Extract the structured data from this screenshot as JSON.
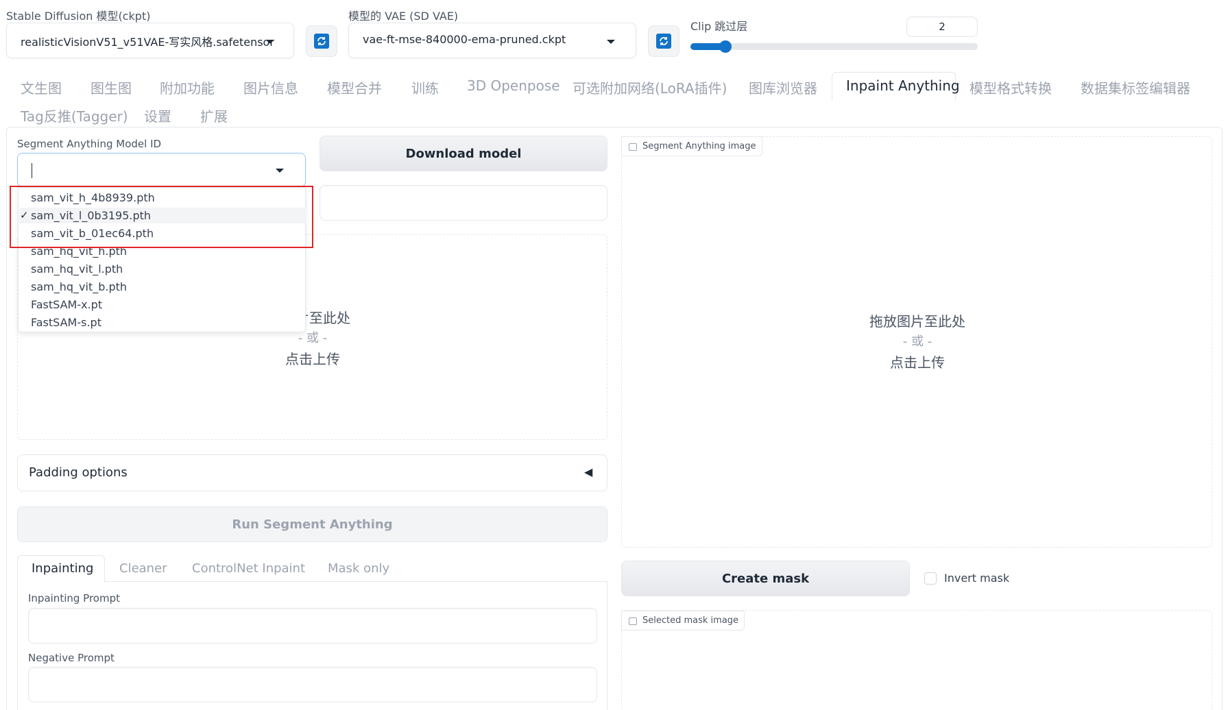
{
  "header": {
    "sd_model_label": "Stable Diffusion 模型(ckpt)",
    "sd_model_value": "realisticVisionV51_v51VAE-写实风格.safetensor",
    "vae_label": "模型的 VAE (SD VAE)",
    "vae_value": "vae-ft-mse-840000-ema-pruned.ckpt",
    "clip_label": "Clip 跳过层",
    "clip_value": "2",
    "clip_slider_fraction": 0.1
  },
  "tabs": [
    {
      "label": "文生图"
    },
    {
      "label": "图生图"
    },
    {
      "label": "附加功能"
    },
    {
      "label": "图片信息"
    },
    {
      "label": "模型合并"
    },
    {
      "label": "训练"
    },
    {
      "label": "3D Openpose"
    },
    {
      "label": "可选附加网络(LoRA插件)"
    },
    {
      "label": "图库浏览器"
    },
    {
      "label": "Inpaint Anything"
    },
    {
      "label": "模型格式转换"
    },
    {
      "label": "数据集标签编辑器"
    },
    {
      "label": "Tag反推(Tagger)"
    },
    {
      "label": "设置"
    },
    {
      "label": "扩展"
    }
  ],
  "left": {
    "model_id_label": "Segment Anything Model ID",
    "model_id_value": "",
    "download_button": "Download model",
    "download_status": "",
    "dropdown_options": [
      {
        "label": "sam_vit_h_4b8939.pth",
        "selected": false
      },
      {
        "label": "sam_vit_l_0b3195.pth",
        "selected": true
      },
      {
        "label": "sam_vit_b_01ec64.pth",
        "selected": false
      },
      {
        "label": "sam_hq_vit_h.pth",
        "selected": false
      },
      {
        "label": "sam_hq_vit_l.pth",
        "selected": false
      },
      {
        "label": "sam_hq_vit_b.pth",
        "selected": false
      },
      {
        "label": "FastSAM-x.pt",
        "selected": false
      },
      {
        "label": "FastSAM-s.pt",
        "selected": false
      }
    ],
    "check_mark": "✓",
    "upload_line1": "片至此处",
    "upload_or": "- 或 -",
    "upload_line3": "点击上传",
    "padding_label": "Padding options",
    "padding_toggle": "◀",
    "run_button": "Run Segment Anything",
    "subtabs": [
      {
        "label": "Inpainting"
      },
      {
        "label": "Cleaner"
      },
      {
        "label": "ControlNet Inpaint"
      },
      {
        "label": "Mask only"
      }
    ],
    "inpainting_prompt_label": "Inpainting Prompt",
    "inpainting_prompt_value": "",
    "negative_prompt_label": "Negative Prompt",
    "negative_prompt_value": ""
  },
  "right": {
    "sa_image_label": "Segment Anything image",
    "drop_line1": "拖放图片至此处",
    "drop_or": "- 或 -",
    "drop_line3": "点击上传",
    "create_mask_button": "Create mask",
    "invert_mask_label": "Invert mask",
    "invert_mask_checked": false,
    "selected_mask_label": "Selected mask image"
  },
  "colors": {
    "accent_blue": "#1273c9",
    "highlight_red": "#e02424"
  }
}
